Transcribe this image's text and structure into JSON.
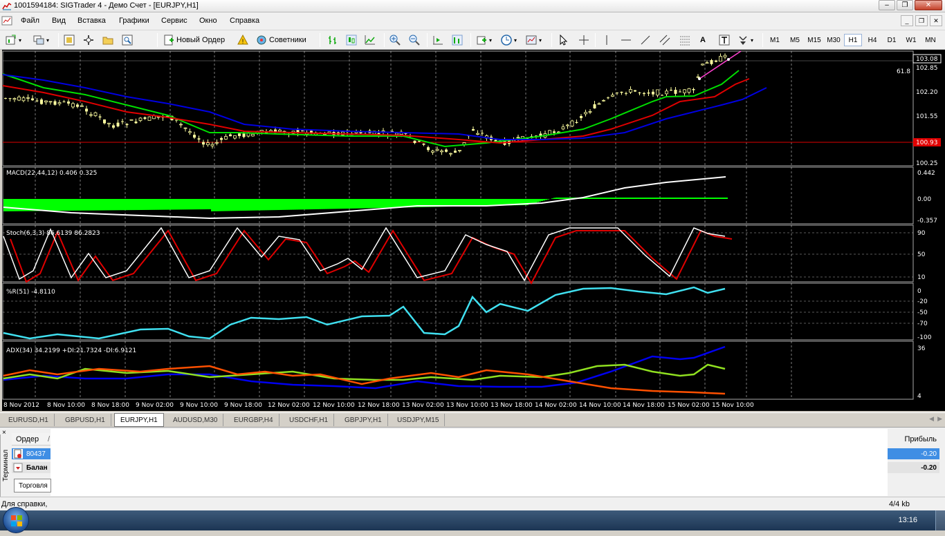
{
  "window": {
    "title": "1001594184: SIGTrader 4 - Демо Счет - [EURJPY,H1]"
  },
  "menu": [
    "Файл",
    "Вид",
    "Вставка",
    "Графики",
    "Сервис",
    "Окно",
    "Справка"
  ],
  "toolbar": {
    "new_order": "Новый Ордер",
    "advisors": "Советники",
    "timeframes": [
      "M1",
      "M5",
      "M15",
      "M30",
      "H1",
      "H4",
      "D1",
      "W1",
      "MN"
    ],
    "active_timeframe": "H1",
    "text_tool": "A"
  },
  "chart": {
    "symbol": "EURJPY",
    "timeframe": "H1",
    "price_labels": [
      "103.08",
      "102.85",
      "102.20",
      "101.55",
      "100.93",
      "100.25"
    ],
    "current_price": "103.08",
    "hline_price": "100.93",
    "fib_label": "61.8",
    "macd": {
      "label": "MACD(22,44,12) 0.406 0.325",
      "scale": [
        "0.442",
        "0.00",
        "-0.357"
      ]
    },
    "stoch": {
      "label": "Stoch(6,3,3) 86.6139 86.2823",
      "scale": [
        "90",
        "50",
        "10"
      ]
    },
    "wpr": {
      "label": "%R(51) -4.8110",
      "scale": [
        "0",
        "-20",
        "-50",
        "-70",
        "-100"
      ]
    },
    "adx": {
      "label": "ADX(34) 34.2199 +DI:21.7324 -DI:6.9121",
      "scale": [
        "36",
        "4"
      ]
    },
    "time_labels": [
      "8 Nov 2012",
      "8 Nov 10:00",
      "8 Nov 18:00",
      "9 Nov 02:00",
      "9 Nov 10:00",
      "9 Nov 18:00",
      "12 Nov 02:00",
      "12 Nov 10:00",
      "12 Nov 18:00",
      "13 Nov 02:00",
      "13 Nov 10:00",
      "13 Nov 18:00",
      "14 Nov 02:00",
      "14 Nov 10:00",
      "14 Nov 18:00",
      "15 Nov 02:00",
      "15 Nov 10:00"
    ],
    "colors": {
      "bull": "#ffffa0",
      "ma_fast": "#00e000",
      "ma_mid": "#e00000",
      "ma_slow": "#0000e0",
      "macd_hist": "#00ff00",
      "signal": "#ffffff",
      "stoch_main": "#ffffff",
      "stoch_signal": "#e00000",
      "wpr": "#40e0f0",
      "adx": "#0000f0",
      "plus_di": "#90e020",
      "minus_di": "#ff5000",
      "hline": "#e00000"
    }
  },
  "tabs": [
    "EURUSD,H1",
    "GBPUSD,H1",
    "EURJPY,H1",
    "AUDUSD,M30",
    "EURGBP,H4",
    "USDCHF,H1",
    "GBPJPY,H1",
    "USDJPY,M15"
  ],
  "active_tab": "EURJPY,H1",
  "terminal": {
    "side_label": "Терминал",
    "close": "×",
    "col_order": "Ордер",
    "col_sort": "/",
    "col_profit": "Прибыль",
    "order_id": "80437",
    "balance_label": "Балан",
    "order_profit": "-0.20",
    "balance_profit": "-0.20",
    "tab_trade": "Торговля"
  },
  "status": {
    "help": "Для справки,",
    "traffic": "4/4 kb"
  },
  "taskbar": {
    "time": "13:16"
  }
}
